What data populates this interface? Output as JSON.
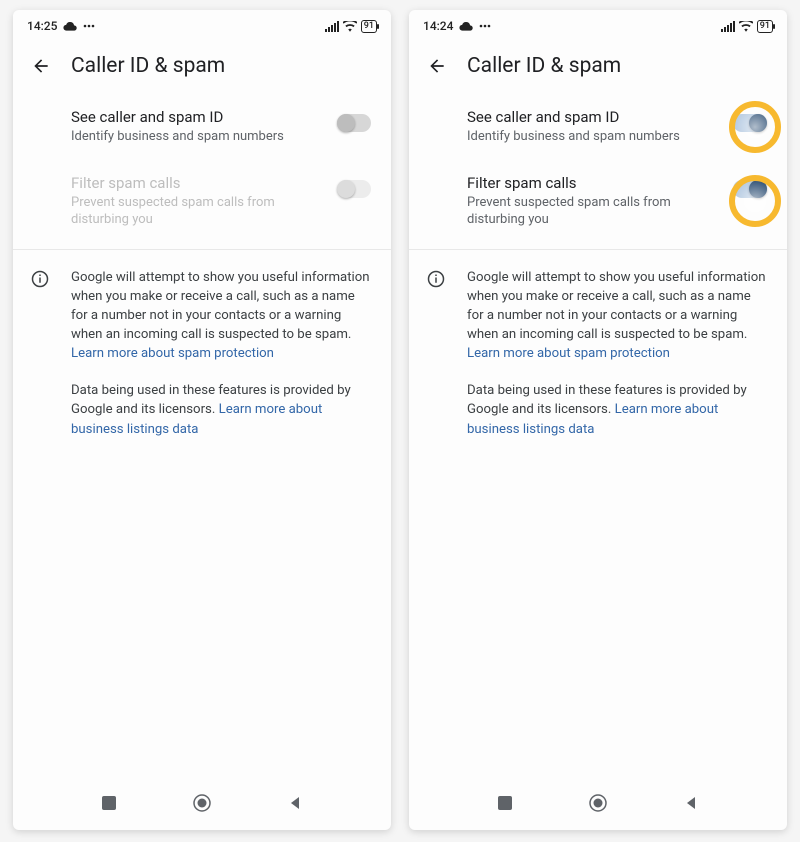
{
  "screens": [
    {
      "status": {
        "time": "14:25",
        "battery": "91"
      },
      "title": "Caller ID & spam",
      "settings": [
        {
          "title": "See caller and spam ID",
          "sub": "Identify business and spam numbers",
          "state": "off",
          "enabled": true,
          "highlight": false
        },
        {
          "title": "Filter spam calls",
          "sub": "Prevent suspected spam calls from disturbing you",
          "state": "off",
          "enabled": false,
          "highlight": false
        }
      ],
      "info": {
        "p1a": "Google will attempt to show you useful information when you make or receive a call, such as a name for a number not in your contacts or a warning when an incoming call is suspected to be spam. ",
        "p1link": "Learn more about spam protection",
        "p2a": "Data being used in these features is provided by Google and its licensors. ",
        "p2link": "Learn more about business listings data"
      }
    },
    {
      "status": {
        "time": "14:24",
        "battery": "91"
      },
      "title": "Caller ID & spam",
      "settings": [
        {
          "title": "See caller and spam ID",
          "sub": "Identify business and spam numbers",
          "state": "on",
          "enabled": true,
          "highlight": true
        },
        {
          "title": "Filter spam calls",
          "sub": "Prevent suspected spam calls from disturbing you",
          "state": "on",
          "enabled": true,
          "highlight": true
        }
      ],
      "info": {
        "p1a": "Google will attempt to show you useful information when you make or receive a call, such as a name for a number not in your contacts or a warning when an incoming call is suspected to be spam. ",
        "p1link": "Learn more about spam protection",
        "p2a": "Data being used in these features is provided by Google and its licensors. ",
        "p2link": "Learn more about business listings data"
      }
    }
  ]
}
